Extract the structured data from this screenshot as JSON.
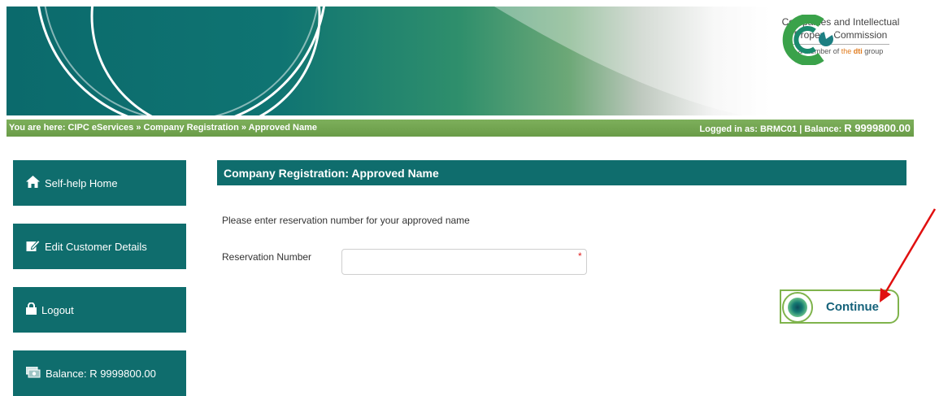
{
  "header": {
    "logo_line1": "Companies and Intellectual",
    "logo_line2": "Property Commission",
    "logo_member_prefix": "a member of ",
    "logo_member_the": "the ",
    "logo_member_dti": "dti",
    "logo_member_suffix": " group"
  },
  "breadcrumb": {
    "prefix": "You are here: ",
    "path": "CIPC eServices » Company Registration » Approved Name",
    "login_prefix": "Logged in as: ",
    "user": "BRMC01",
    "balance_sep": " | Balance: ",
    "balance_value": "R 9999800.00"
  },
  "sidebar": {
    "items": [
      {
        "label": "Self-help Home",
        "icon": "home-icon"
      },
      {
        "label": "Edit Customer Details",
        "icon": "edit-icon"
      },
      {
        "label": "Logout",
        "icon": "lock-icon"
      },
      {
        "label": "Balance: R 9999800.00",
        "icon": "money-icon"
      }
    ]
  },
  "main": {
    "title": "Company Registration: Approved Name",
    "instruction": "Please enter reservation number for your approved name",
    "field_label": "Reservation Number",
    "field_value": "",
    "required_mark": "*",
    "continue_label": "Continue"
  },
  "colors": {
    "teal": "#0f6d6d",
    "green_bar": "#7daf5b",
    "button_border": "#7fb34c",
    "arrow": "#e01010"
  }
}
